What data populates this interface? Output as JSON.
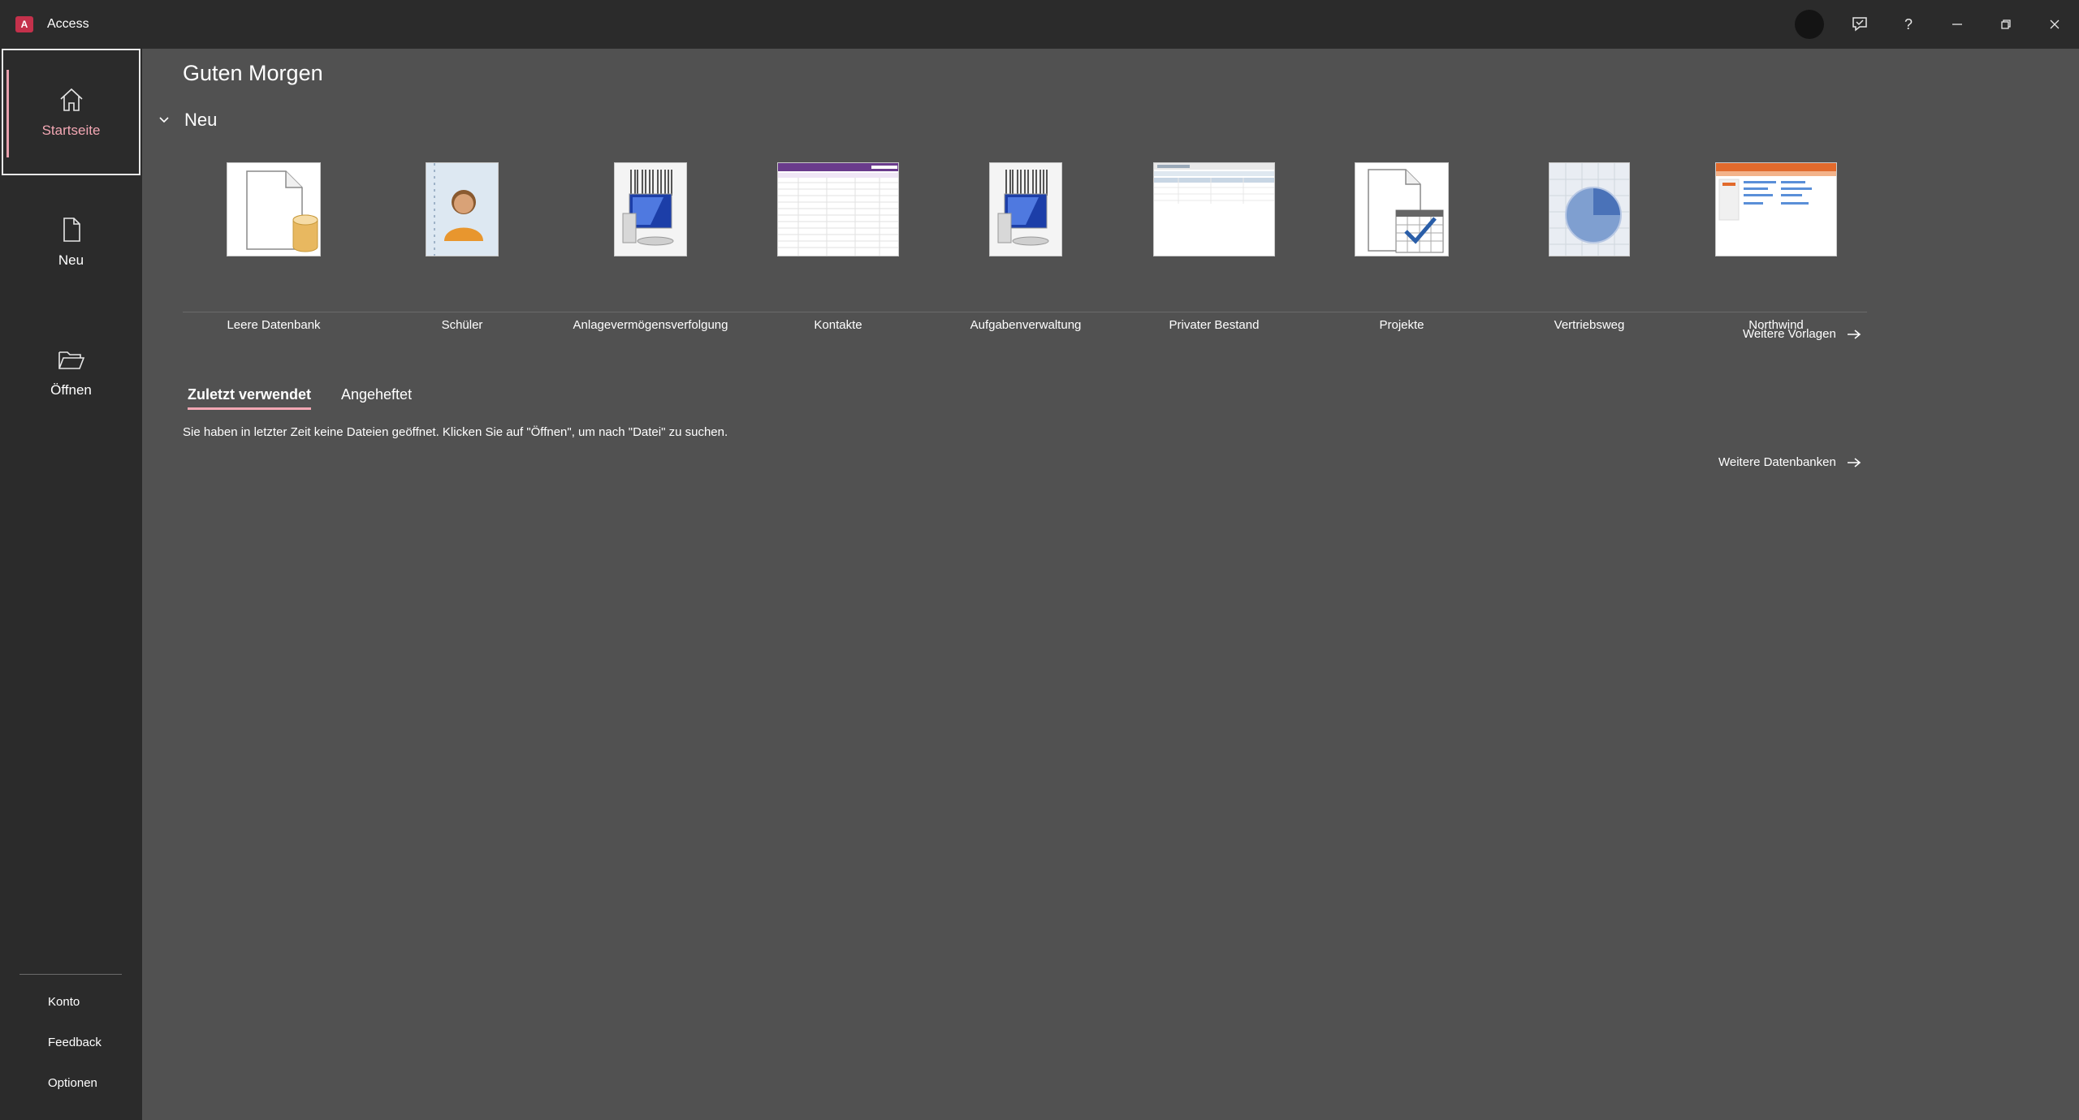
{
  "app": {
    "title": "Access",
    "logo_letter": "A"
  },
  "titlebar": {
    "icons": [
      "profile-avatar",
      "feedback-icon",
      "help-icon",
      "minimize-icon",
      "restore-icon",
      "close-icon"
    ],
    "help_label": "?"
  },
  "sidebar": {
    "items": [
      {
        "label": "Startseite",
        "icon": "home-icon",
        "active": true
      },
      {
        "label": "Neu",
        "icon": "new-document-icon",
        "active": false
      },
      {
        "label": "Öffnen",
        "icon": "open-folder-icon",
        "active": false
      }
    ],
    "bottom": [
      "Konto",
      "Feedback",
      "Optionen"
    ]
  },
  "main": {
    "greeting": "Guten Morgen",
    "new_section_title": "Neu",
    "templates": [
      {
        "label": "Leere Datenbank",
        "icon": "blank-database-icon"
      },
      {
        "label": "Schüler",
        "icon": "students-icon"
      },
      {
        "label": "Anlagevermögensverfolgung",
        "icon": "asset-tracking-icon"
      },
      {
        "label": "Kontakte",
        "icon": "contacts-thumbnail"
      },
      {
        "label": "Aufgabenverwaltung",
        "icon": "task-management-icon"
      },
      {
        "label": "Privater Bestand",
        "icon": "home-inventory-thumbnail"
      },
      {
        "label": "Projekte",
        "icon": "projects-icon"
      },
      {
        "label": "Vertriebsweg",
        "icon": "sales-pipeline-icon"
      },
      {
        "label": "Northwind",
        "icon": "northwind-thumbnail"
      }
    ],
    "more_templates": "Weitere Vorlagen",
    "tabs": [
      {
        "label": "Zuletzt verwendet",
        "active": true
      },
      {
        "label": "Angeheftet",
        "active": false
      }
    ],
    "empty_message": "Sie haben in letzter Zeit keine Dateien geöffnet. Klicken Sie auf \"Öffnen\", um nach \"Datei\" zu suchen.",
    "more_databases": "Weitere Datenbanken"
  },
  "colors": {
    "accent": "#f2a7b3",
    "brand": "#c4314b",
    "background": "#515151",
    "chrome": "#2b2b2b"
  }
}
